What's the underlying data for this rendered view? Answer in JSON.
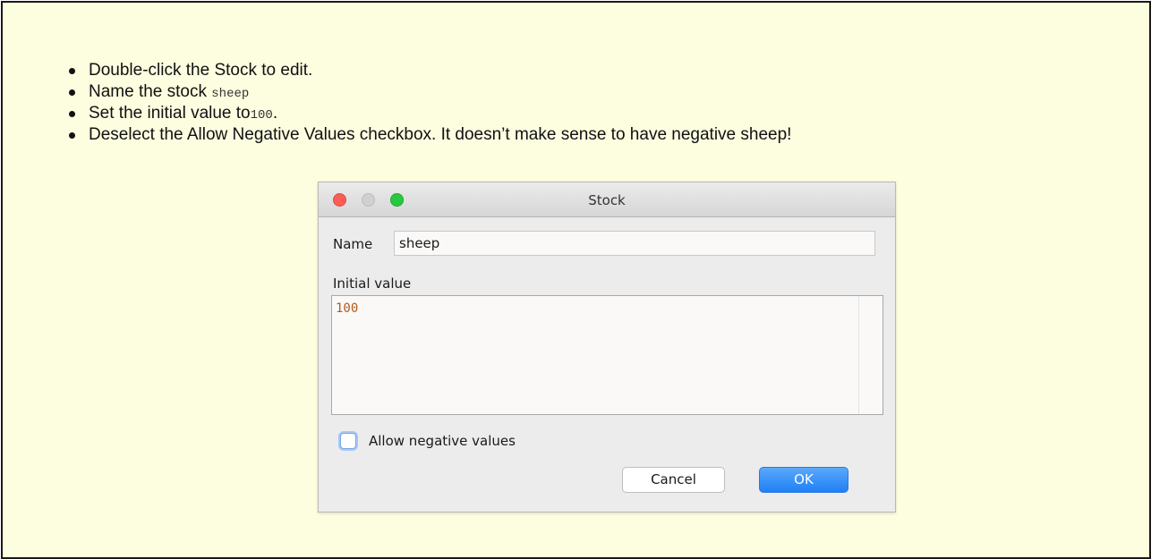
{
  "instructions": [
    {
      "text": "Double-click the Stock to edit."
    },
    {
      "text": "Name the stock ",
      "code": "sheep"
    },
    {
      "text": "Set the initial value to",
      "code": "100",
      "suffix": "."
    },
    {
      "text": "Deselect the Allow Negative Values checkbox. It doesn’t make sense to have negative sheep!"
    }
  ],
  "dialog": {
    "title": "Stock",
    "name_label": "Name",
    "name_value": "sheep",
    "initial_label": "Initial value",
    "initial_value": "100",
    "allow_negative_label": "Allow negative values",
    "allow_negative_checked": false,
    "cancel_label": "Cancel",
    "ok_label": "OK"
  },
  "colors": {
    "panel_background": "#fdfde0",
    "accent": "#1f80f5",
    "code_value": "#b05a1e"
  },
  "icons": [
    "close-dot",
    "minimize-dot",
    "zoom-dot",
    "checkbox-unchecked"
  ]
}
